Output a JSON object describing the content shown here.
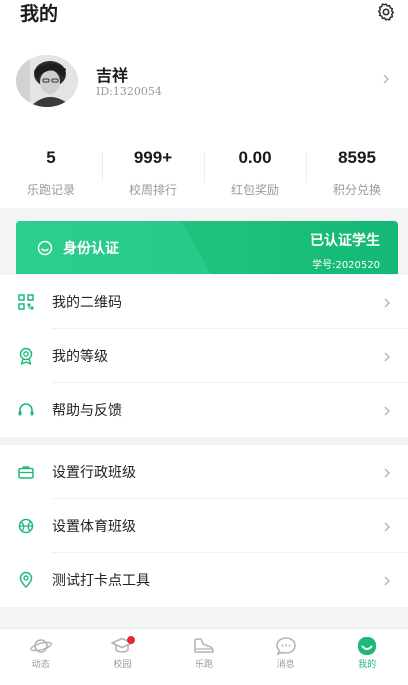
{
  "header": {
    "title": "我的",
    "settings_icon": "gear-icon"
  },
  "profile": {
    "name": "吉祥",
    "id_text": "ID:1320054"
  },
  "stats": [
    {
      "value": "5",
      "label": "乐跑记录"
    },
    {
      "value": "999+",
      "label": "校周排行"
    },
    {
      "value": "0.00",
      "label": "红包奖励"
    },
    {
      "value": "8595",
      "label": "积分兑换"
    }
  ],
  "verify": {
    "title": "身份认证",
    "status": "已认证学生",
    "student_id": "学号:2020520"
  },
  "menu": [
    {
      "label": "我的二维码",
      "icon": "qr-code-icon"
    },
    {
      "label": "我的等级",
      "icon": "medal-icon"
    },
    {
      "label": "帮助与反馈",
      "icon": "headset-icon"
    },
    {
      "label": "设置行政班级",
      "icon": "briefcase-icon"
    },
    {
      "label": "设置体育班级",
      "icon": "ball-icon"
    },
    {
      "label": "测试打卡点工具",
      "icon": "location-pin-icon"
    }
  ],
  "tabs": [
    {
      "label": "动态",
      "icon": "planet-icon",
      "active": false
    },
    {
      "label": "校园",
      "icon": "graduation-cap-icon",
      "active": false,
      "badge": true
    },
    {
      "label": "乐跑",
      "icon": "sneaker-icon",
      "active": false
    },
    {
      "label": "消息",
      "icon": "chat-bubble-icon",
      "active": false
    },
    {
      "label": "我的",
      "icon": "smiley-face-icon",
      "active": true
    }
  ],
  "colors": {
    "accent": "#1fb87a",
    "badge": "#e6283b",
    "separator": "#f3f4f4"
  }
}
